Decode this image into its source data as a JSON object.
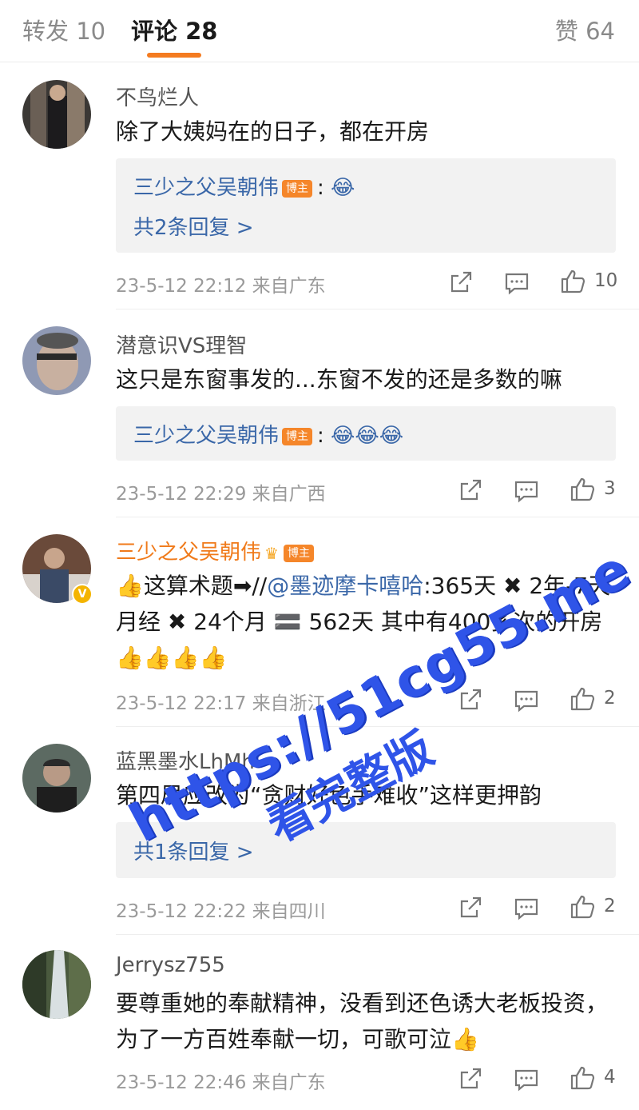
{
  "tabs": {
    "repost": "转发 10",
    "comments": "评论 28",
    "likes": "赞 64"
  },
  "author_tag": "博主",
  "comments": [
    {
      "user": "不鸟烂人",
      "text": "除了大姨妈在的日子，都在开房",
      "reply_user": "三少之父吴朝伟",
      "reply_emoji": "😂",
      "reply_more": "共2条回复 >",
      "time": "23-5-12 22:12",
      "location": "来自广东",
      "likes": "10"
    },
    {
      "user": "潜意识VS理智",
      "text": "这只是东窗事发的...东窗不发的还是多数的嘛",
      "reply_user": "三少之父吴朝伟",
      "reply_emoji": "😂😂😂",
      "time": "23-5-12 22:29",
      "location": "来自广西",
      "likes": "3"
    },
    {
      "user": "三少之父吴朝伟",
      "text_prefix": "👍这算术题➡//",
      "mention": "@墨迹摩卡嘻哈",
      "text_suffix": ":365天 ✖ 2年-7天月经 ✖ 24个月 🟰 562天  其中有400多次的开房 👍👍👍👍",
      "time": "23-5-12 22:17",
      "location": "来自浙江",
      "likes": "2"
    },
    {
      "user": "蓝黑墨水LhMh",
      "text": "第四局应改为“贪财好色手难收”这样更押韵",
      "reply_more": "共1条回复 >",
      "time": "23-5-12 22:22",
      "location": "来自四川",
      "likes": "2"
    },
    {
      "user": "Jerrysz755",
      "text": "要尊重她的奉献精神，没看到还色诱大老板投资，为了一方百姓奉献一切，可歌可泣👍",
      "time": "23-5-12 22:46",
      "location": "来自广东",
      "likes": "4"
    }
  ],
  "watermark": {
    "url": "https://51cg55.me",
    "text": "看完整版"
  },
  "colors": {
    "accent": "#f47b20",
    "link": "#3a67a8",
    "watermark": "#2f54e8"
  }
}
